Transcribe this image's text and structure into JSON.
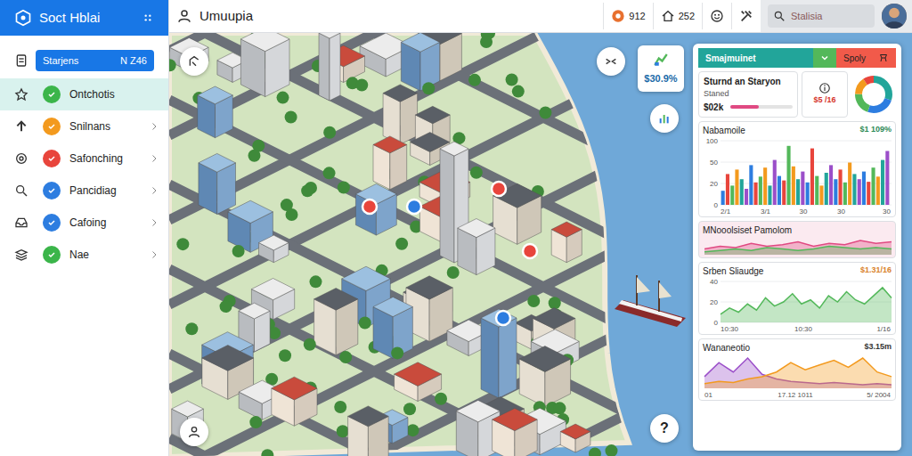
{
  "app": {
    "title": "Soct Hblai"
  },
  "sidebar": {
    "button": {
      "label": "Starjens",
      "badge": "N Z46"
    },
    "items": [
      {
        "label": "Ontchotis",
        "selected": true,
        "color": "#3bb54a"
      },
      {
        "label": "Snilnans",
        "selected": false,
        "color": "#f39a1e"
      },
      {
        "label": "Safonching",
        "selected": false,
        "color": "#e8453c"
      },
      {
        "label": "Pancidiag",
        "selected": false,
        "color": "#2d7de0"
      },
      {
        "label": "Cafoing",
        "selected": false,
        "color": "#2d7de0"
      },
      {
        "label": "Nae",
        "selected": false,
        "color": "#3bb54a"
      }
    ]
  },
  "topbar": {
    "title": "Umuupia",
    "stats": [
      {
        "value": "912",
        "color": "#e8702e"
      },
      {
        "value": "252",
        "color": "#333333"
      }
    ],
    "search": {
      "placeholder": "Stalisia"
    }
  },
  "map": {
    "badge": "$30.9%",
    "help": "?"
  },
  "panel": {
    "tabs": [
      {
        "label": "Smajmuinet",
        "selected": true
      },
      {
        "label": "Spoly",
        "selected": false
      }
    ],
    "summary": {
      "title": "Sturnd an Staryon",
      "label": "Staned",
      "value": "$02k",
      "level": 0.45
    },
    "alert": {
      "value": "$5 /16"
    },
    "donut": [
      {
        "value": 30,
        "color": "#22a59a"
      },
      {
        "value": 25,
        "color": "#2d7de0"
      },
      {
        "value": 20,
        "color": "#53b85a"
      },
      {
        "value": 15,
        "color": "#f39a1e"
      },
      {
        "value": 10,
        "color": "#e8453c"
      }
    ],
    "charts": [
      {
        "kind": "bar",
        "title": "Nabamoile",
        "value": "$1 109%",
        "value_color": "#2e8b57",
        "y_ticks": [
          "100",
          "50",
          "20",
          "0"
        ],
        "x_ticks": [
          "2/1",
          "3/1",
          "30",
          "30",
          "30"
        ],
        "series": [
          {
            "color": "#2d7de0",
            "values": [
              22,
              48,
              30,
              55,
              40,
              25,
              62,
              35,
              44,
              58,
              30,
              70,
              45,
              38,
              92,
              60,
              40,
              52,
              35,
              88,
              45,
              30,
              50,
              62,
              40,
              55,
              35,
              66,
              48,
              40,
              52,
              36,
              58,
              44,
              70,
              84
            ]
          }
        ]
      },
      {
        "kind": "strip",
        "title": "MNooolsiset Pamolom",
        "value": "",
        "value_color": "#333333",
        "y_ticks": [],
        "x_ticks": [],
        "series": [
          {
            "color": "#e04a82",
            "values": [
              4,
              6,
              5,
              8,
              6,
              7,
              9,
              6,
              8,
              7,
              10,
              8,
              9
            ]
          },
          {
            "color": "#53b85a",
            "values": [
              2,
              3,
              4,
              3,
              5,
              4,
              3,
              4,
              6,
              5,
              4,
              5,
              4
            ]
          }
        ]
      },
      {
        "kind": "area",
        "title": "Srben Sliaudge",
        "value": "$1.31/16",
        "value_color": "#d9822b",
        "y_ticks": [
          "40",
          "20",
          "0"
        ],
        "x_ticks": [
          "10:30",
          "10:30",
          "1/16"
        ],
        "series": [
          {
            "color": "#53b85a",
            "values": [
              8,
              14,
              10,
              18,
              12,
              24,
              16,
              20,
              28,
              18,
              22,
              14,
              26,
              20,
              30,
              22,
              18,
              26,
              34,
              24
            ]
          }
        ]
      },
      {
        "kind": "area",
        "title": "Wananeotio",
        "value": "$3.15m",
        "value_color": "#333333",
        "y_ticks": [],
        "x_ticks": [
          "01",
          "17.12 1011",
          "5/ 2004"
        ],
        "series": [
          {
            "color": "#9b4fc9",
            "values": [
              10,
              22,
              14,
              26,
              12,
              8,
              6,
              5,
              4,
              5,
              4,
              3,
              4,
              3
            ]
          },
          {
            "color": "#f39a1e",
            "values": [
              4,
              6,
              5,
              8,
              10,
              14,
              22,
              16,
              20,
              24,
              18,
              26,
              14,
              10
            ]
          }
        ]
      }
    ]
  }
}
